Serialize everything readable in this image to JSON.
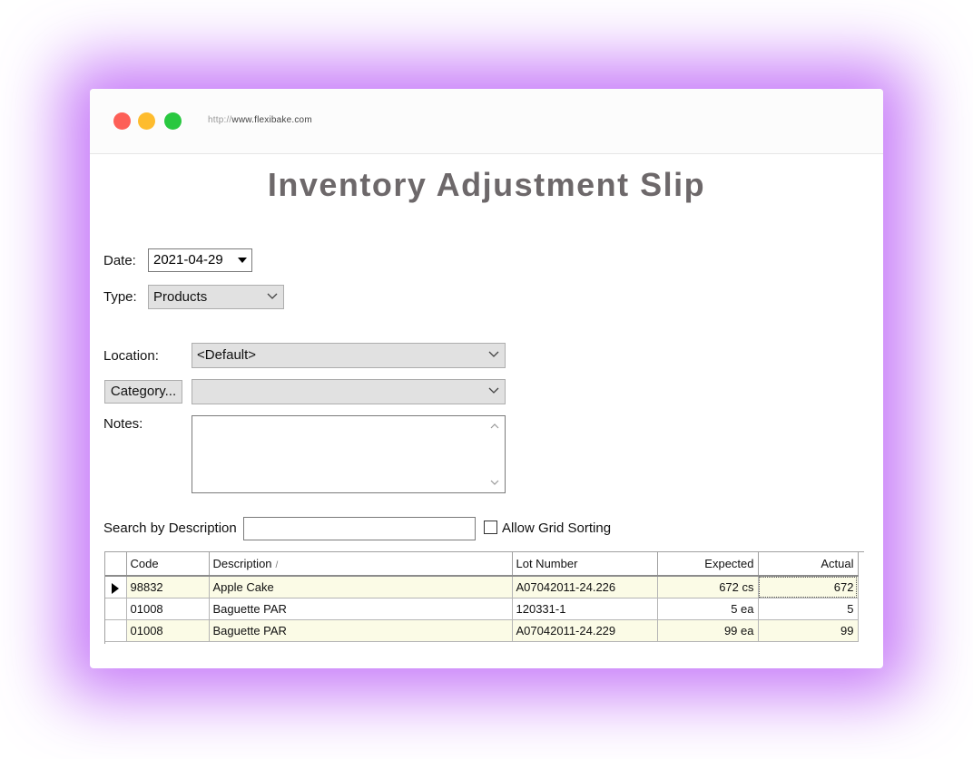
{
  "browser": {
    "url_protocol": "http://",
    "url_host": "www.flexibake.com"
  },
  "page": {
    "title": "Inventory Adjustment Slip"
  },
  "form": {
    "date_label": "Date:",
    "date_value": "2021-04-29",
    "type_label": "Type:",
    "type_value": "Products",
    "location_label": "Location:",
    "location_value": "<Default>",
    "category_button": "Category...",
    "category_value": "",
    "notes_label": "Notes:",
    "notes_value": "",
    "search_label": "Search by Description",
    "search_value": "",
    "allow_sorting_label": "Allow Grid Sorting",
    "allow_sorting_checked": false
  },
  "grid": {
    "columns": [
      "Code",
      "Description",
      "Lot Number",
      "Expected",
      "Actual"
    ],
    "sort_indicator": "/",
    "rows": [
      {
        "code": "98832",
        "description": "Apple Cake",
        "lot": "A07042011-24.226",
        "expected": "672 cs",
        "actual": "672",
        "current": true
      },
      {
        "code": "01008",
        "description": "Baguette PAR",
        "lot": "120331-1",
        "expected": "5 ea",
        "actual": "5",
        "current": false
      },
      {
        "code": "01008",
        "description": "Baguette PAR",
        "lot": "A07042011-24.229",
        "expected": "99 ea",
        "actual": "99",
        "current": false
      }
    ]
  },
  "colors": {
    "glow": "#b450f5",
    "title_text": "#6d686a",
    "row_highlight": "#fbfbe6",
    "dot_red": "#fd5f57",
    "dot_yellow": "#febc2e",
    "dot_green": "#29c840"
  }
}
